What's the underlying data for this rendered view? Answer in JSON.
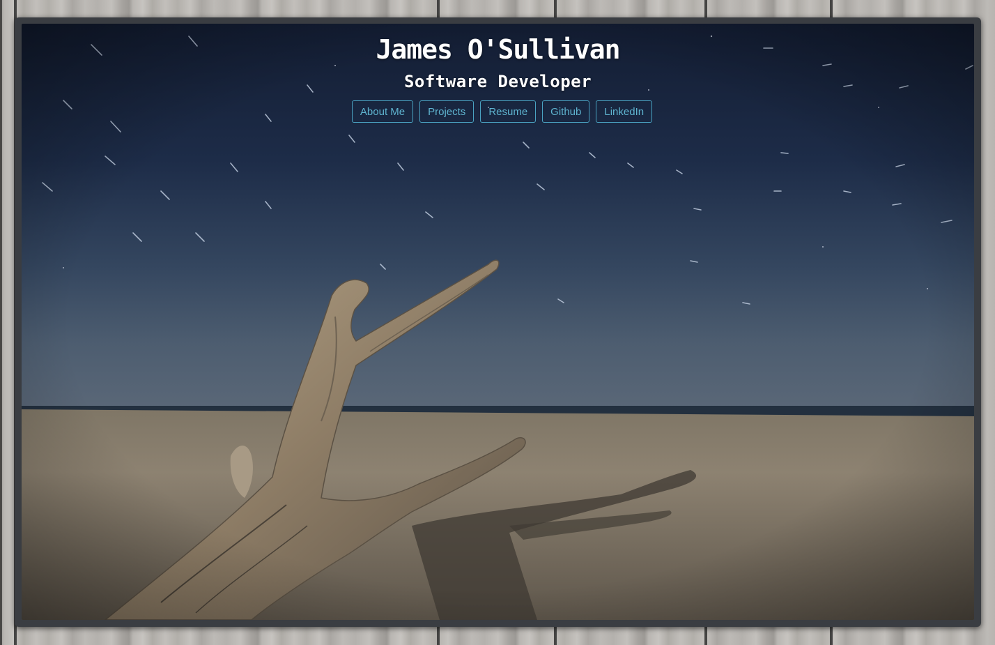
{
  "header": {
    "name": "James O'Sullivan",
    "role": "Software Developer"
  },
  "nav": {
    "items": [
      {
        "label": "About Me"
      },
      {
        "label": "Projects"
      },
      {
        "label": "Resume"
      },
      {
        "label": "Github"
      },
      {
        "label": "LinkedIn"
      }
    ]
  },
  "colors": {
    "accent": "#4aa3c2",
    "frame": "#3a3d42",
    "sky_top": "#16223a",
    "sky_horizon": "#4a5b70",
    "sand": "#8a7e6d"
  }
}
